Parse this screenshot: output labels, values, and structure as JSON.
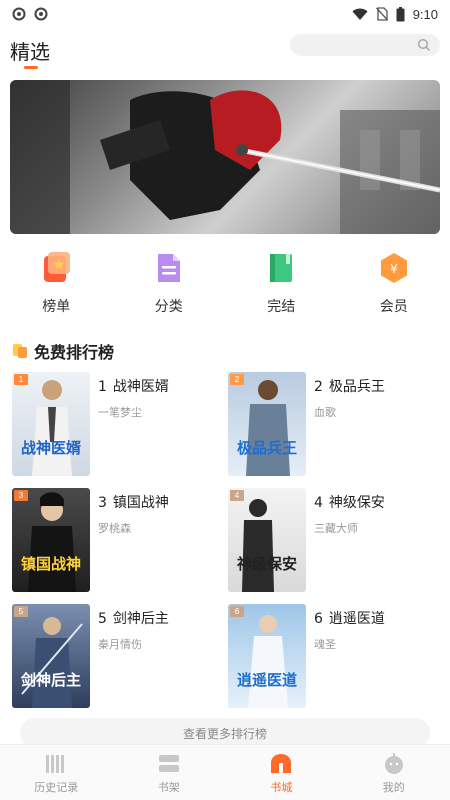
{
  "status_bar": {
    "time": "9:10",
    "icons": [
      "notification-icon",
      "notification-icon",
      "wifi-icon",
      "no-sim-icon",
      "battery-icon"
    ]
  },
  "header": {
    "title": "精选",
    "search_placeholder": ""
  },
  "colors": {
    "accent": "#ff6a2b",
    "rank_1": "#ff8a3d",
    "rank_2": "#ff9a4a",
    "rank_3": "#f07a3a",
    "rank_other": "#c9a58a"
  },
  "categories": [
    {
      "label": "榜单",
      "icon": "ranking-icon"
    },
    {
      "label": "分类",
      "icon": "category-icon"
    },
    {
      "label": "完结",
      "icon": "completed-book-icon"
    },
    {
      "label": "会员",
      "icon": "vip-icon"
    }
  ],
  "section": {
    "title": "免费排行榜"
  },
  "books": [
    {
      "rank": "1",
      "name": "战神医婿",
      "author": "一笔梦尘",
      "cover_text": "战神医婿"
    },
    {
      "rank": "2",
      "name": "极品兵王",
      "author": "血歌",
      "cover_text": "极品兵王"
    },
    {
      "rank": "3",
      "name": "镇国战神",
      "author": "罗桃森",
      "cover_text": "镇国战神"
    },
    {
      "rank": "4",
      "name": "神级保安",
      "author": "三藏大师",
      "cover_text": "神级保安"
    },
    {
      "rank": "5",
      "name": "剑神后主",
      "author": "秦月情伤",
      "cover_text": "剑神后主"
    },
    {
      "rank": "6",
      "name": "逍遥医道",
      "author": "魂圣",
      "cover_text": "逍遥医道"
    }
  ],
  "more_button": "查看更多排行榜",
  "bottom_nav": [
    {
      "label": "历史记录",
      "icon": "history-icon",
      "active": false
    },
    {
      "label": "书架",
      "icon": "bookshelf-icon",
      "active": false
    },
    {
      "label": "书城",
      "icon": "bookstore-icon",
      "active": true
    },
    {
      "label": "我的",
      "icon": "profile-icon",
      "active": false
    }
  ]
}
